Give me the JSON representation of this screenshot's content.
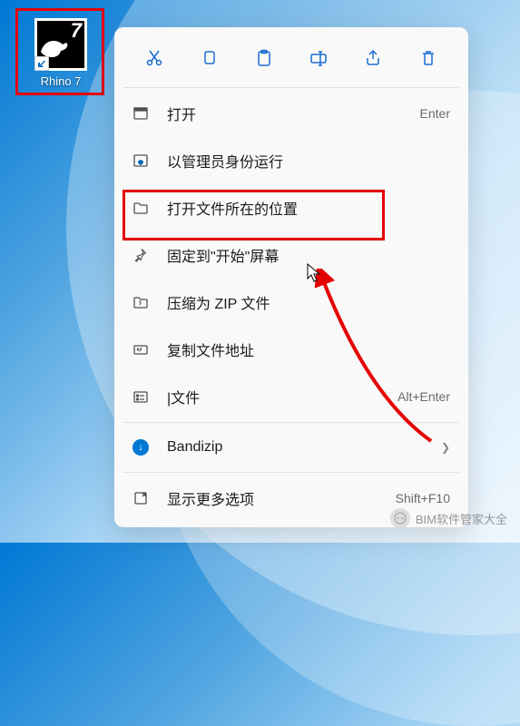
{
  "shortcut": {
    "label": "Rhino 7",
    "badge": "7"
  },
  "toolbar": {
    "cut": "cut-icon",
    "copy": "copy-icon",
    "paste": "paste-icon",
    "rename": "rename-icon",
    "share": "share-icon",
    "delete": "delete-icon"
  },
  "menu": {
    "open": {
      "label": "打开",
      "shortcut": "Enter"
    },
    "run_admin": {
      "label": "以管理员身份运行"
    },
    "open_location": {
      "label": "打开文件所在的位置"
    },
    "pin_start": {
      "label": "固定到\"开始\"屏幕"
    },
    "compress": {
      "label": "压缩为 ZIP 文件"
    },
    "copy_path": {
      "label": "复制文件地址"
    },
    "properties": {
      "label": "|文件",
      "shortcut": "Alt+Enter"
    },
    "bandizip": {
      "label": "Bandizip"
    },
    "more": {
      "label": "显示更多选项",
      "shortcut": "Shift+F10"
    }
  },
  "watermark": {
    "text": "BIM软件管家大全"
  }
}
